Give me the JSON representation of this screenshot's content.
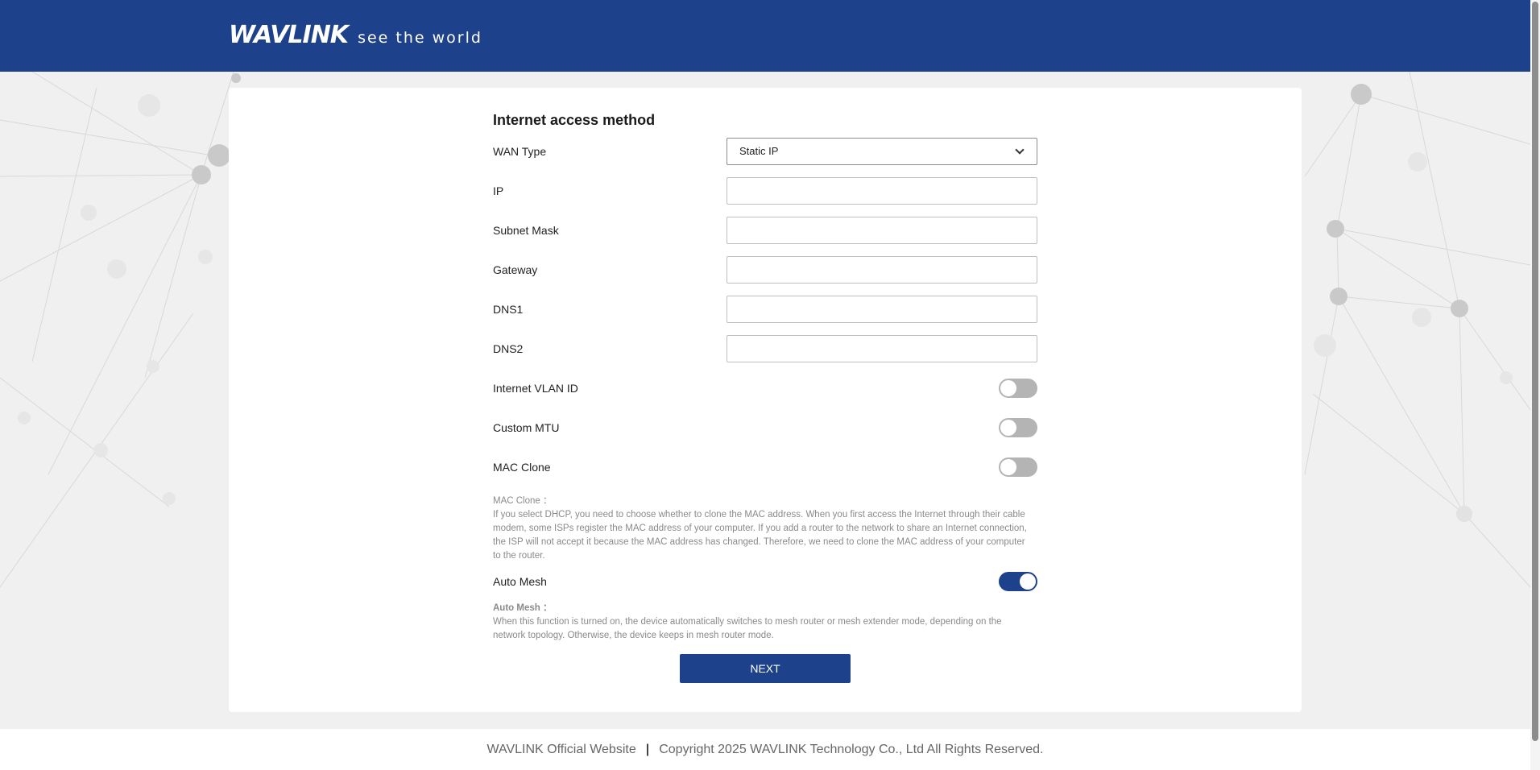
{
  "header": {
    "brand": "WAVLINK",
    "tagline": "see the world",
    "background_color": "#1d418b"
  },
  "form": {
    "title": "Internet access method",
    "wan_type": {
      "label": "WAN Type",
      "value": "Static IP"
    },
    "ip": {
      "label": "IP",
      "value": ""
    },
    "subnet_mask": {
      "label": "Subnet Mask",
      "value": ""
    },
    "gateway": {
      "label": "Gateway",
      "value": ""
    },
    "dns1": {
      "label": "DNS1",
      "value": ""
    },
    "dns2": {
      "label": "DNS2",
      "value": ""
    },
    "internet_vlan_id": {
      "label": "Internet VLAN ID",
      "enabled": false
    },
    "custom_mtu": {
      "label": "Custom MTU",
      "enabled": false
    },
    "mac_clone": {
      "label": "MAC Clone",
      "enabled": false,
      "note_title": "MAC Clone ：",
      "note_text": "If you select DHCP, you need to choose whether to clone the MAC address. When you first access the Internet through their cable modem, some ISPs register the MAC address of your computer. If you add a router to the network to share an Internet connection, the ISP will not accept it because the MAC address has changed. Therefore, we need to clone the MAC address of your computer to the router."
    },
    "auto_mesh": {
      "label": "Auto Mesh",
      "enabled": true,
      "note_title": "Auto Mesh ：",
      "note_text": "When this function is turned on, the device automatically switches to mesh router or mesh extender mode, depending on the network topology. Otherwise, the device keeps in mesh router mode."
    },
    "next_label": "NEXT",
    "accent_color": "#1d418b"
  },
  "footer": {
    "website_link": "WAVLINK Official Website",
    "separator": "|",
    "copyright": "Copyright 2025 WAVLINK Technology Co., Ltd All Rights Reserved."
  }
}
